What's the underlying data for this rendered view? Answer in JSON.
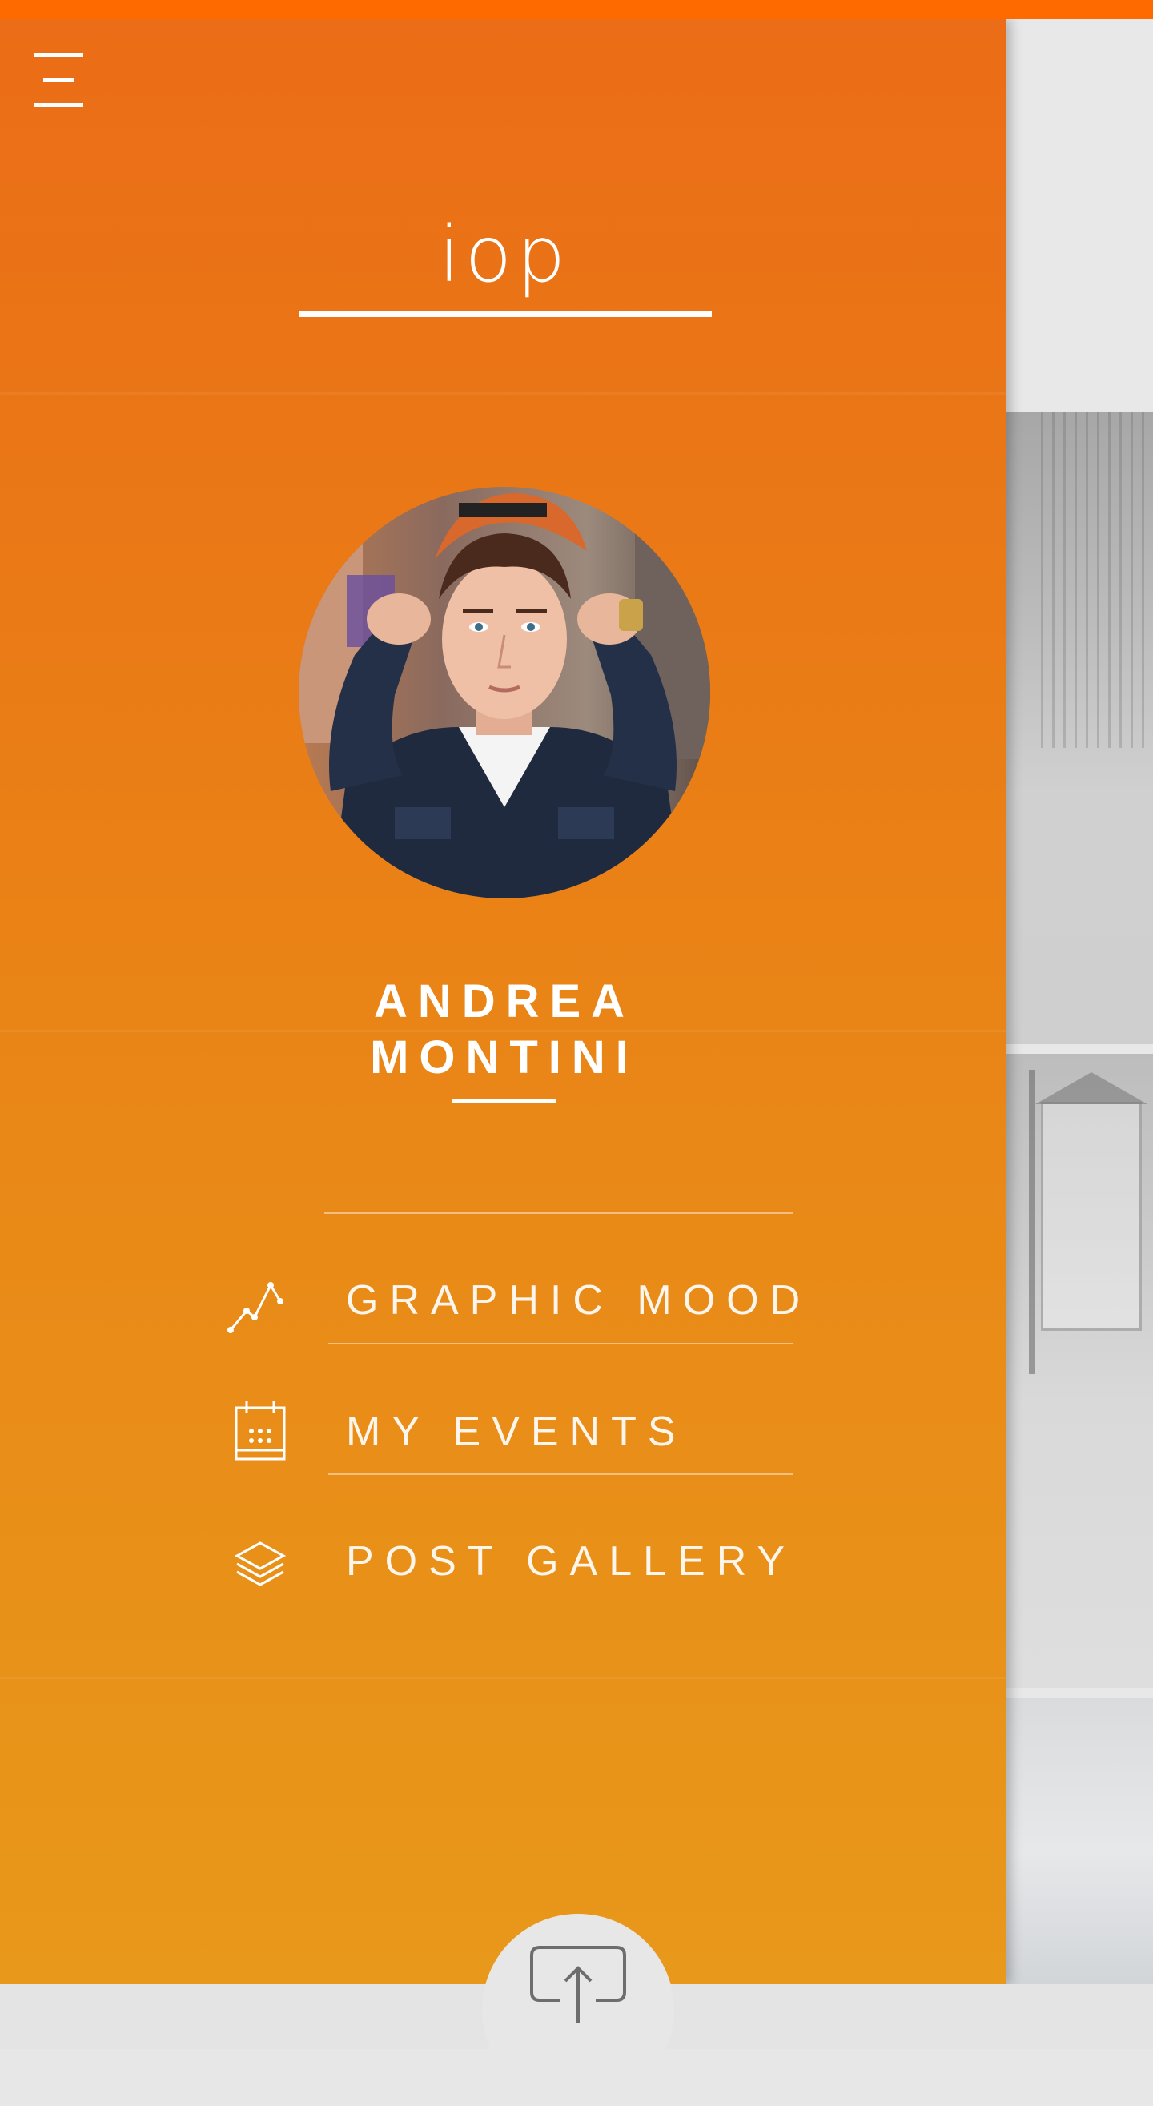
{
  "app": {
    "logo_text": "iop",
    "accent_color": "#ff6a00",
    "drawer_gradient": [
      "#eb6d17",
      "#e8981a"
    ]
  },
  "menu_button": {
    "icon": "hamburger-menu-icon"
  },
  "profile": {
    "first_name": "ANDREA",
    "last_name": "MONTINI",
    "avatar": "user-avatar-photo"
  },
  "nav": {
    "items": [
      {
        "label": "GRAPHIC MOOD",
        "icon": "line-chart-icon"
      },
      {
        "label": "MY EVENTS",
        "icon": "calendar-icon"
      },
      {
        "label": "POST GALLERY",
        "icon": "layers-icon"
      }
    ]
  },
  "upload_button": {
    "icon": "upload-icon"
  }
}
